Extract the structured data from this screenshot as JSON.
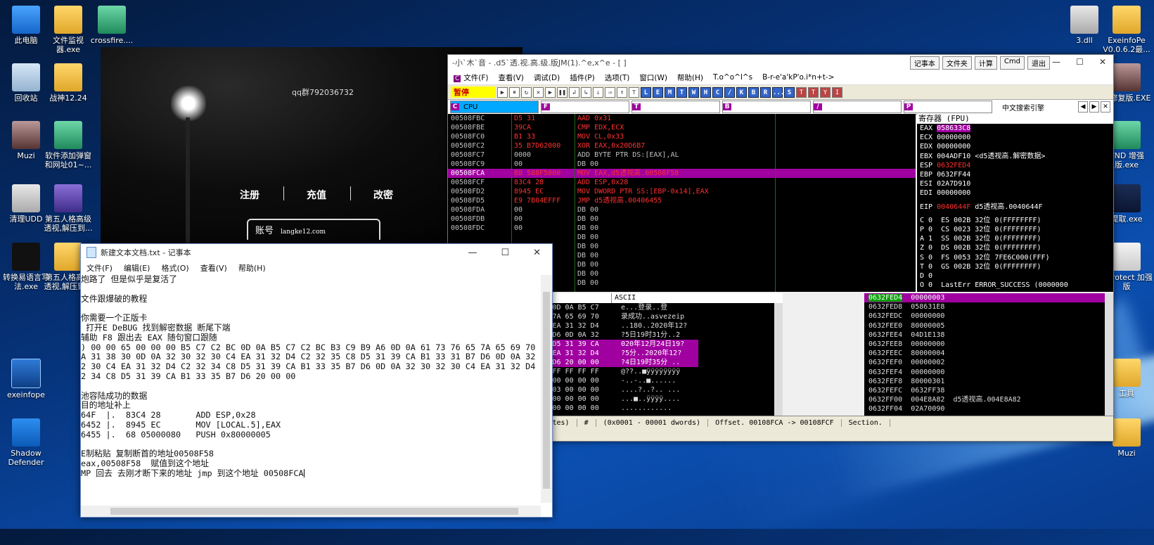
{
  "desktop": {
    "left_icons": [
      {
        "label": "此电脑",
        "icon": "computer-icon"
      },
      {
        "label": "文件监视器.exe",
        "icon": "monitor-app-icon"
      },
      {
        "label": "crossfire....",
        "icon": "crossfire-icon"
      },
      {
        "label": "回收站",
        "icon": "recycle-bin-icon"
      },
      {
        "label": "战神12.24",
        "icon": "folder-icon"
      },
      {
        "label": "Muzi",
        "icon": "photo-icon"
      },
      {
        "label": "软件添加弹窗和网址01~...",
        "icon": "app-icon"
      },
      {
        "label": "清理UDD",
        "icon": "gear-doc-icon"
      },
      {
        "label": "第五人格高级透视,解压到...",
        "icon": "rar-archive-icon"
      },
      {
        "label": "转换易语言写法.exe",
        "icon": "text-app-icon"
      },
      {
        "label": "第五人格高级透视,解压到...",
        "icon": "folder-icon"
      },
      {
        "label": "exeinfope",
        "icon": "exe-icon"
      },
      {
        "label": "Shadow Defender",
        "icon": "shadow-defender-icon"
      }
    ],
    "right_icons": [
      {
        "label": "3.dll",
        "icon": "dll-file-icon"
      },
      {
        "label": "ExeinfoPe V0.0.6.2最...",
        "icon": "folder-icon"
      },
      {
        "label": "子修复版.EXE",
        "icon": "photo-icon"
      },
      {
        "label": "VND 增强版.exe",
        "icon": "app-icon"
      },
      {
        "label": "提取.exe",
        "icon": "sail-icon"
      },
      {
        "label": "MProtect 加强版",
        "icon": "doc-icon"
      },
      {
        "label": "工具",
        "icon": "folder-icon"
      },
      {
        "label": "Muzi",
        "icon": "folder-icon"
      }
    ]
  },
  "game": {
    "qq": "qq群792036732",
    "menu": [
      "注册",
      "充值",
      "改密"
    ],
    "account_label": "账号",
    "account_value": "langke12.com"
  },
  "olly": {
    "title": "-小`木`音 - .d5`透.视.高.级.版JM(1).^e,x^e - [ ]",
    "title_buttons": [
      "记事本",
      "文件夹",
      "计算",
      "Cmd",
      "退出"
    ],
    "menus": [
      "文件(F)",
      "查看(V)",
      "调试(D)",
      "插件(P)",
      "选项(T)",
      "窗口(W)",
      "帮助(H)",
      "T.o^o^l^s",
      "B-r-e'a'kP'o.i*n+t->"
    ],
    "pause": "暂停",
    "toolbar_letters": [
      "L",
      "E",
      "M",
      "T",
      "W",
      "H",
      "C",
      "/",
      "K",
      "B",
      "R",
      "...",
      "S"
    ],
    "toolbar_pink": [
      "T",
      "T",
      "Y",
      "I"
    ],
    "tabs": [
      {
        "letter": "C",
        "name": "CPU"
      },
      {
        "letter": "F",
        "name": ""
      },
      {
        "letter": "T",
        "name": ""
      },
      {
        "letter": "B",
        "name": ""
      },
      {
        "letter": "/",
        "name": ""
      },
      {
        "letter": "P",
        "name": ""
      }
    ],
    "search_tab": "中文搜索引擎",
    "disasm": [
      {
        "addr": "00508FBC",
        "hex": "D5 31",
        "asm": "AAD 0x31",
        "style": "red"
      },
      {
        "addr": "00508FBE",
        "hex": "39CA",
        "asm": "CMP EDX,ECX",
        "style": "red"
      },
      {
        "addr": "00508FC0",
        "hex": "B1 33",
        "asm": "MOV CL,0x33",
        "style": "red"
      },
      {
        "addr": "00508FC2",
        "hex": "35 B7D62000",
        "asm": "XOR EAX,0x20D6B7",
        "style": "red"
      },
      {
        "addr": "00508FC7",
        "hex": "0000",
        "asm": "ADD BYTE PTR DS:[EAX],AL",
        "style": "dim"
      },
      {
        "addr": "00508FC9",
        "hex": "00",
        "asm": "DB 00",
        "style": "dim"
      },
      {
        "addr": "00508FCA",
        "hex": "B8 588F5000",
        "asm": "MOV EAX,d5透视高.00508F58",
        "style": "sel"
      },
      {
        "addr": "00508FCF",
        "hex": "83C4 28",
        "asm": "ADD ESP,0x28",
        "style": "red"
      },
      {
        "addr": "00508FD2",
        "hex": "8945 EC",
        "asm": "MOV DWORD PTR SS:[EBP-0x14],EAX",
        "style": "red"
      },
      {
        "addr": "00508FD5",
        "hex": "E9 7B04EFFF",
        "asm": "JMP d5透视高.00406455",
        "style": "red"
      },
      {
        "addr": "00508FDA",
        "hex": "00",
        "asm": "DB 00",
        "style": "dim"
      },
      {
        "addr": "00508FDB",
        "hex": "00",
        "asm": "DB 00",
        "style": "dim"
      },
      {
        "addr": "00508FDC",
        "hex": "00",
        "asm": "DB 00",
        "style": "dim"
      },
      {
        "addr": "",
        "hex": "",
        "asm": "DB 00",
        "style": "dim"
      },
      {
        "addr": "",
        "hex": "",
        "asm": "DB 00",
        "style": "dim"
      },
      {
        "addr": "",
        "hex": "",
        "asm": "DB 00",
        "style": "dim"
      },
      {
        "addr": "",
        "hex": "",
        "asm": "DB 00",
        "style": "dim"
      },
      {
        "addr": "",
        "hex": "",
        "asm": "DB 00",
        "style": "dim"
      },
      {
        "addr": "",
        "hex": "",
        "asm": "DB 00",
        "style": "dim"
      }
    ],
    "registers_header": "寄存器 (FPU)",
    "registers": [
      {
        "name": "EAX",
        "value": "058633C8",
        "note": "",
        "style": "hl"
      },
      {
        "name": "ECX",
        "value": "00000000",
        "note": "",
        "style": ""
      },
      {
        "name": "EDX",
        "value": "00000000",
        "note": "",
        "style": ""
      },
      {
        "name": "EBX",
        "value": "004ADF10",
        "note": "<d5透视高.解密数据>",
        "style": ""
      },
      {
        "name": "ESP",
        "value": "0632FED4",
        "note": "",
        "style": "red"
      },
      {
        "name": "EBP",
        "value": "0632FF44",
        "note": "",
        "style": ""
      },
      {
        "name": "ESI",
        "value": "02A7D910",
        "note": "",
        "style": ""
      },
      {
        "name": "EDI",
        "value": "00000000",
        "note": "",
        "style": ""
      }
    ],
    "eip": {
      "name": "EIP",
      "value": "0040644F",
      "note": "d5透视高.0040644F"
    },
    "flags": [
      "C 0  ES 002B 32位 0(FFFFFFFF)",
      "P 0  CS 0023 32位 0(FFFFFFFF)",
      "A 1  SS 002B 32位 0(FFFFFFFF)",
      "Z 0  DS 002B 32位 0(FFFFFFFF)",
      "S 0  FS 0053 32位 7FE6C000(FFF)",
      "T 0  GS 002B 32位 0(FFFFFFFF)",
      "D 0",
      "O 0  LastErr ERROR_SUCCESS (0000000"
    ],
    "dump_header": "ASCII",
    "dump": [
      {
        "hex": "65 00 00 00 B5 C7 C2 BC 0D 0A B5 C7",
        "ascii": "e...登录..登",
        "hi": false
      },
      {
        "hex": "B9 A6 0D 0A 61 73 76 65 7A 65 69 70",
        "ascii": "录成功..asvezeip",
        "hi": false
      },
      {
        "hex": "30 0D 0A 32 30 32 30 C4 EA 31 32 D4",
        "ascii": "..180..2020年12?",
        "hi": false
      },
      {
        "hex": "D5 31 39 CA B1 33 31 B7 D6 0D 0A 32",
        "ascii": "?5日19时31分..2",
        "hi": false
      },
      {
        "hex": "EA 31 32 D4 C2 32 34 C8 D5 31 39 CA",
        "ascii": "020年12月24日19?",
        "hi": true
      },
      {
        "hex": "D6 0D 0A 32 30 32 30 C4 EA 31 32 D4",
        "ascii": "?5分..2020年12?",
        "hi": true
      },
      {
        "hex": "D5 31 39 CA B1 33 35 B7 D6 20 00 00",
        "ascii": "?4日19时35分 ..",
        "hi": true
      },
      {
        "hex": "00 0A 00 80 FF FF FF FF FF FF FF FF",
        "ascii": "@??..■ÿÿÿÿÿÿÿÿ",
        "hi": false
      },
      {
        "hex": "02 00 00 00 08 00 00 00 00 00 00 00",
        "ascii": "-..-..■......",
        "hi": false
      },
      {
        "hex": "FB 03 00 00 FB 03 00 00 03 00 00 00",
        "ascii": "....?..?.. ...",
        "hi": false
      },
      {
        "hex": "18 00 00 00 FF FF FF FF 00 00 00 00",
        "ascii": "...■..ÿÿÿÿ....",
        "hi": false
      },
      {
        "hex": "00 00 00 00 00 00 00 00 00 00 00 00",
        "ascii": "............",
        "hi": false
      }
    ],
    "stack": [
      {
        "addr": "0632FED4",
        "value": "00000003",
        "note": "",
        "sel": true
      },
      {
        "addr": "0632FED8",
        "value": "058631E8",
        "note": "",
        "sel": false
      },
      {
        "addr": "0632FEDC",
        "value": "00000000",
        "note": "",
        "sel": false
      },
      {
        "addr": "0632FEE0",
        "value": "80000005",
        "note": "",
        "sel": false
      },
      {
        "addr": "0632FEE4",
        "value": "04D1E138",
        "note": "",
        "sel": false
      },
      {
        "addr": "0632FEE8",
        "value": "00000000",
        "note": "",
        "sel": false
      },
      {
        "addr": "0632FEEC",
        "value": "80000004",
        "note": "",
        "sel": false
      },
      {
        "addr": "0632FEF0",
        "value": "00000002",
        "note": "",
        "sel": false
      },
      {
        "addr": "0632FEF4",
        "value": "00000000",
        "note": "",
        "sel": false
      },
      {
        "addr": "0632FEF8",
        "value": "80000301",
        "note": "",
        "sel": false
      },
      {
        "addr": "0632FEFC",
        "value": "0632FF38",
        "note": "",
        "sel": false
      },
      {
        "addr": "0632FF00",
        "value": "004E8A82",
        "note": "d5透视高.004E8A82",
        "sel": false
      },
      {
        "addr": "0632FF04",
        "value": "02A70090",
        "note": "",
        "sel": false
      }
    ],
    "status": [
      "Size.(0x0005 - 00005 bytes)",
      "#",
      "(0x0001 - 00001 dwords)",
      "Offset. 00108FCA -> 00108FCF",
      "Section."
    ]
  },
  "notepad": {
    "title": "新建文本文档.txt - 记事本",
    "menus": [
      "文件(F)",
      "编辑(E)",
      "格式(O)",
      "查看(V)",
      "帮助(H)"
    ],
    "lines": [
      "炮路了 但是似乎是复活了",
      "",
      "文件跟爆破的教程",
      "",
      "你需要一个正版卡",
      " 打开E DeBUG 找到解密数据 断尾下端",
      "辅助 F8 跟出去 EAX 随句窗口跟随",
      ") 00 00 65 00 00 00 B5 C7 C2 BC 0D 0A B5 C7 C2 BC B3 C9 B9 A6 0D 0A 61 73 76 65 7A 65 69 70",
      "A 31 38 30 0D 0A 32 30 32 30 C4 EA 31 32 D4 C2 32 35 C8 D5 31 39 CA B1 33 31 B7 D6 0D 0A 32",
      "2 30 C4 EA 31 32 D4 C2 32 34 C8 D5 31 39 CA B1 33 35 B7 D6 0D 0A 32 30 32 30 C4 EA 31 32 D4",
      "2 34 C8 D5 31 39 CA B1 33 35 B7 D6 20 00 00",
      "",
      "池容陆成功的数据",
      "目的地址补上",
      "64F  |.  83C4 28       ADD ESP,0x28",
      "6452 |.  8945 EC       MOV [LOCAL.5],EAX",
      "6455 |.  68 05000080   PUSH 0x80000005",
      "",
      "E制粘贴 复制断首的地址00508F58",
      "eax,00508F58  赋值到这个地址",
      "MP 回去 去刚才断下来的地址 jmp 到这个地址 00508FCA"
    ]
  }
}
